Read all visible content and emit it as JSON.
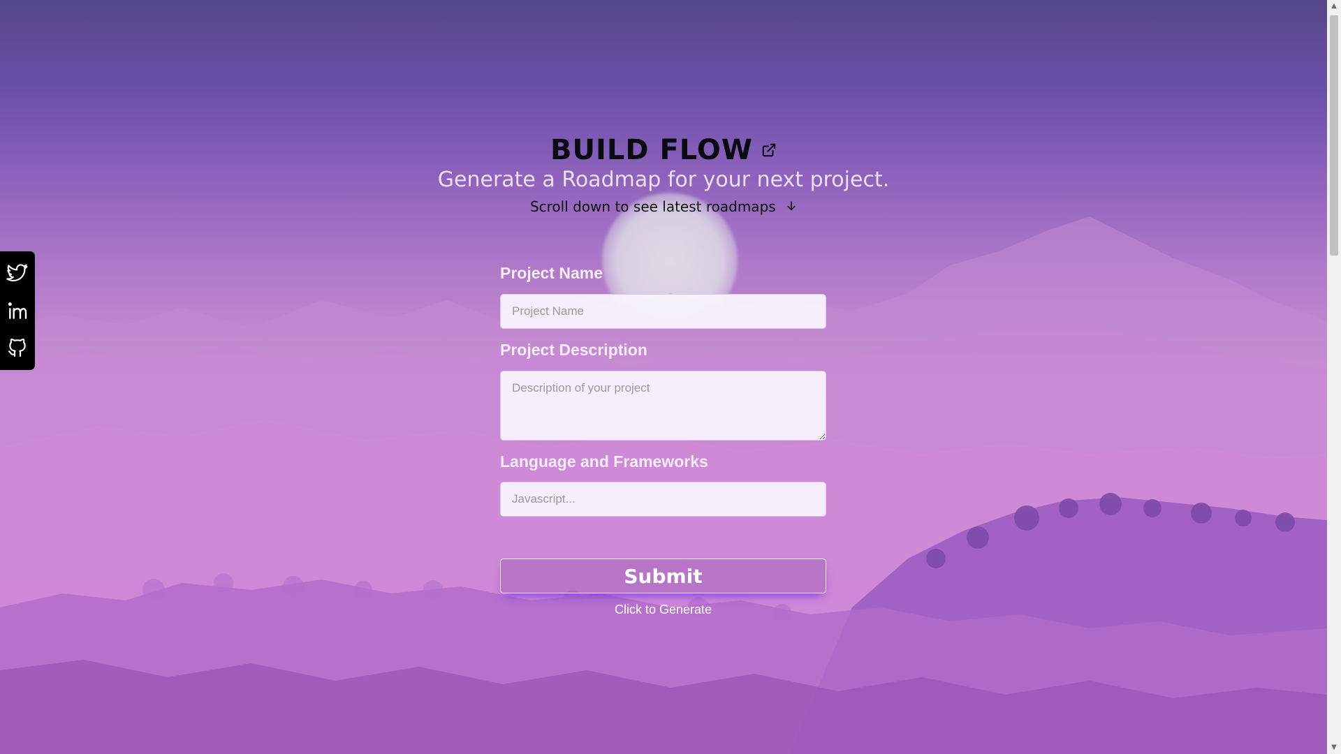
{
  "header": {
    "title": "BUILD FLOW",
    "subtitle": "Generate a Roadmap for your next project.",
    "scroll_hint": "Scroll down to see latest roadmaps",
    "scroll_hint_icon": "arrow-down-icon",
    "title_link_icon": "external-link-icon"
  },
  "social": {
    "items": [
      {
        "icon": "twitter-icon"
      },
      {
        "icon": "linkedin-icon"
      },
      {
        "icon": "github-icon"
      }
    ]
  },
  "form": {
    "project_name": {
      "label": "Project Name",
      "placeholder": "Project Name",
      "value": ""
    },
    "project_description": {
      "label": "Project Description",
      "placeholder": "Description of your project",
      "value": ""
    },
    "languages": {
      "label": "Language and Frameworks",
      "placeholder": "Javascript...",
      "value": ""
    },
    "submit_label": "Submit",
    "submit_hint": "Click to Generate"
  },
  "colors": {
    "sky_top": "#564789",
    "sky_bottom": "#d882d7",
    "hills": "#9a5fc0",
    "social_bar": "#000000",
    "title": "#0a0a10",
    "subtitle": "#ecdff5"
  }
}
